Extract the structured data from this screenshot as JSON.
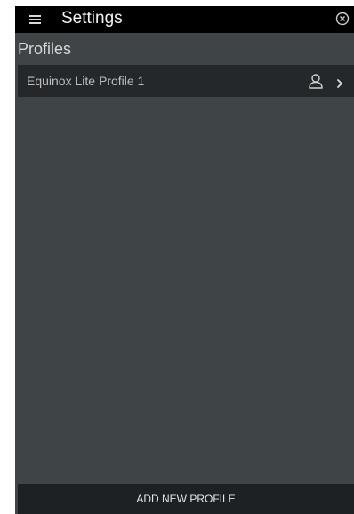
{
  "header": {
    "title": "Settings"
  },
  "section": {
    "heading": "Profiles"
  },
  "profiles": [
    {
      "name": "Equinox Lite Profile 1"
    }
  ],
  "footer": {
    "add_button_label": "ADD NEW PROFILE"
  },
  "colors": {
    "topbar": "#000000",
    "background": "#3f4447",
    "row": "#25282b",
    "footer_button": "#1e2124"
  },
  "icons": {
    "menu": "hamburger-menu-icon",
    "close": "close-circle-icon",
    "profile": "person-outline-icon",
    "chevron": "chevron-right-icon"
  }
}
